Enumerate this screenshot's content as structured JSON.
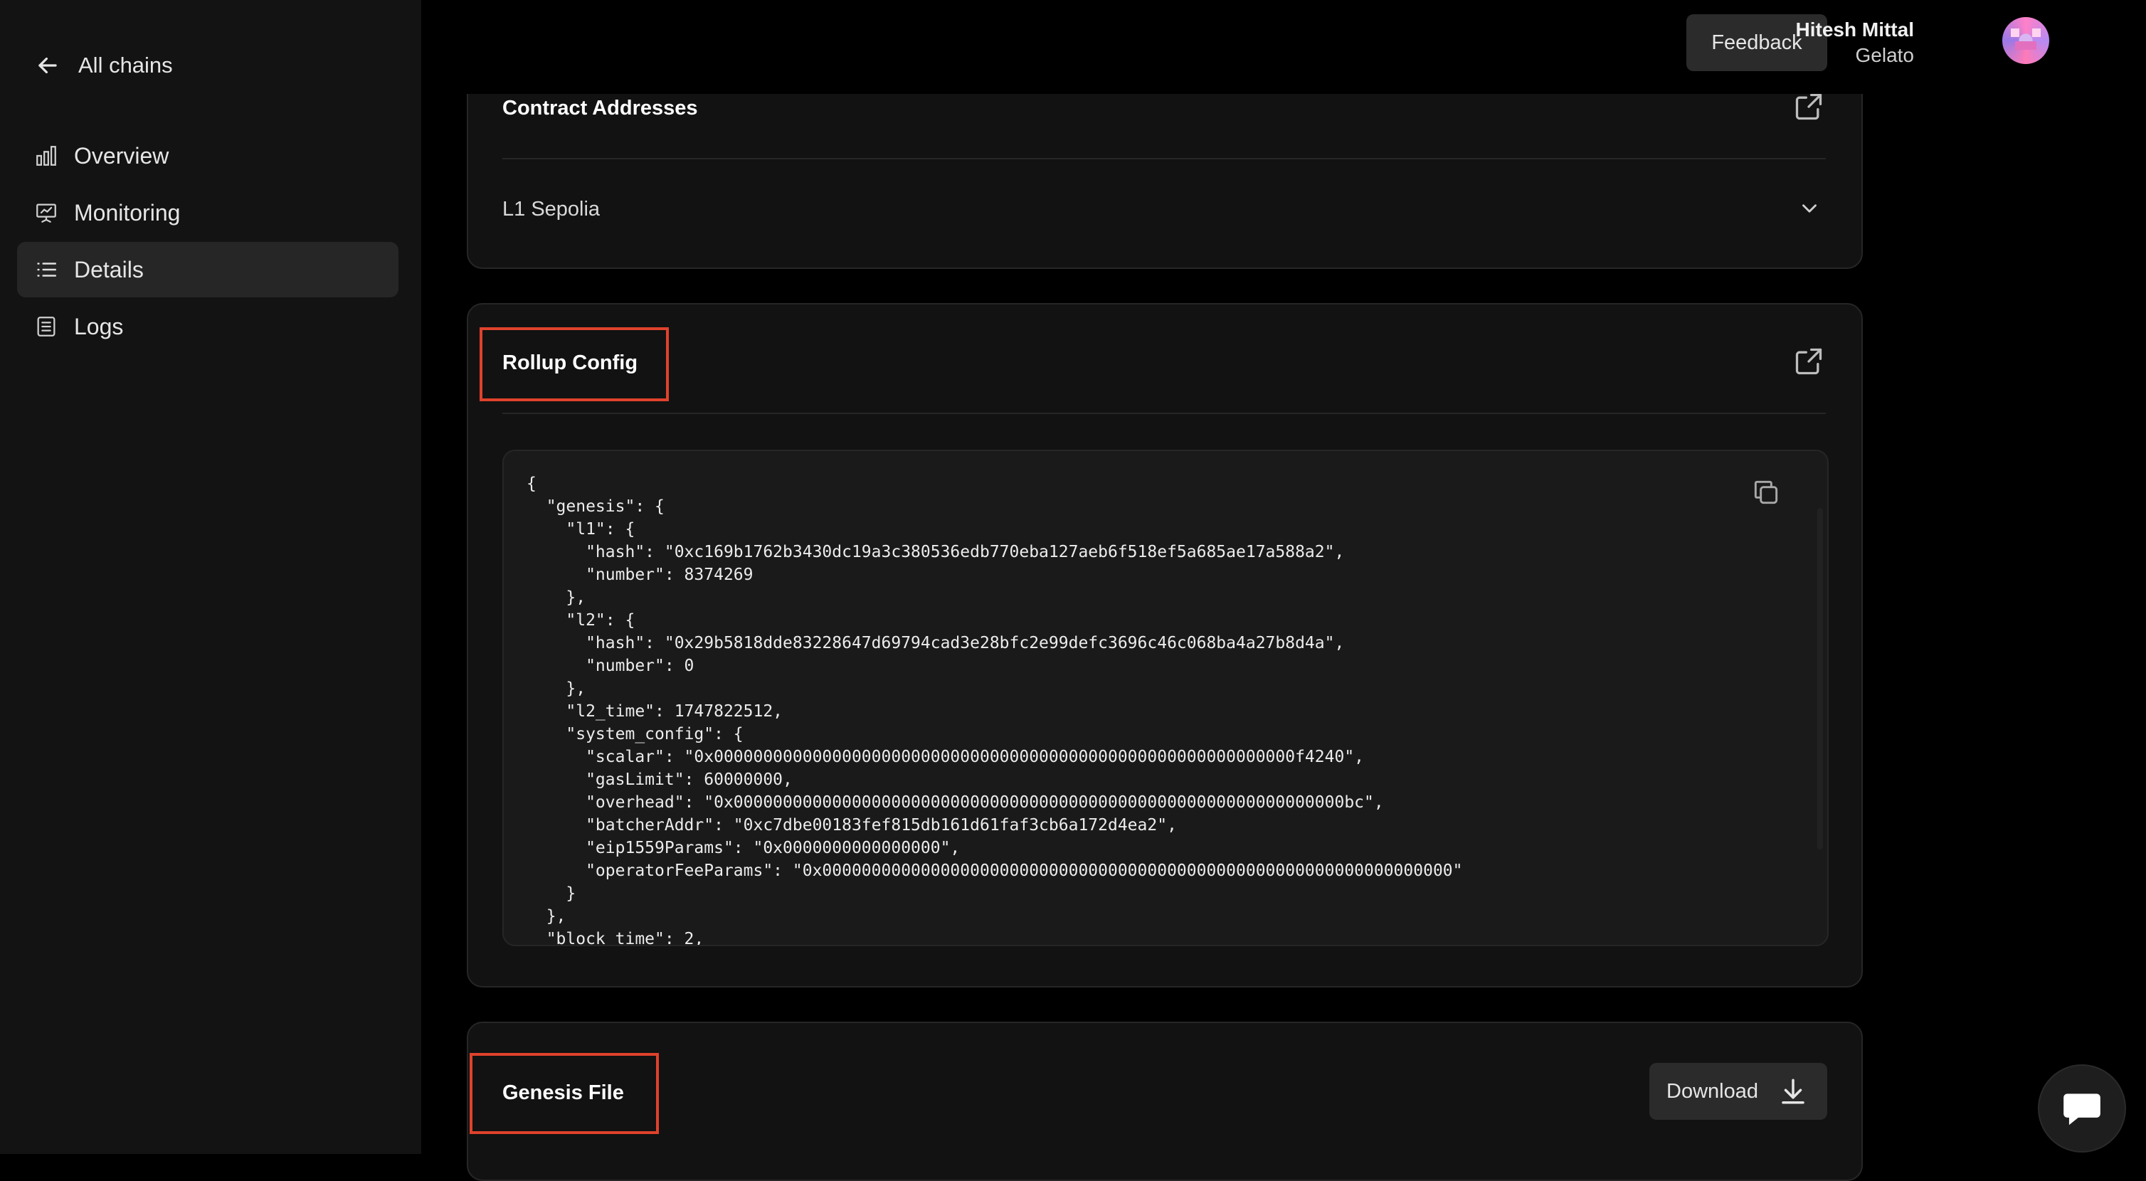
{
  "sidebar": {
    "back_label": "All chains",
    "items": [
      {
        "label": "Overview",
        "icon": "bar-chart-icon"
      },
      {
        "label": "Monitoring",
        "icon": "presentation-icon"
      },
      {
        "label": "Details",
        "icon": "list-icon",
        "active": true
      },
      {
        "label": "Logs",
        "icon": "log-icon"
      }
    ]
  },
  "header": {
    "feedback_label": "Feedback",
    "user_name": "Hitesh Mittal",
    "user_org": "Gelato"
  },
  "contract_addresses": {
    "title": "Contract Addresses",
    "network": "L1 Sepolia"
  },
  "rollup_config": {
    "title": "Rollup Config",
    "code": "{\n  \"genesis\": {\n    \"l1\": {\n      \"hash\": \"0xc169b1762b3430dc19a3c380536edb770eba127aeb6f518ef5a685ae17a588a2\",\n      \"number\": 8374269\n    },\n    \"l2\": {\n      \"hash\": \"0x29b5818dde83228647d69794cad3e28bfc2e99defc3696c46c068ba4a27b8d4a\",\n      \"number\": 0\n    },\n    \"l2_time\": 1747822512,\n    \"system_config\": {\n      \"scalar\": \"0x00000000000000000000000000000000000000000000000000000000000f4240\",\n      \"gasLimit\": 60000000,\n      \"overhead\": \"0x00000000000000000000000000000000000000000000000000000000000000bc\",\n      \"batcherAddr\": \"0xc7dbe00183fef815db161d61faf3cb6a172d4ea2\",\n      \"eip1559Params\": \"0x0000000000000000\",\n      \"operatorFeeParams\": \"0x0000000000000000000000000000000000000000000000000000000000000000\"\n    }\n  },\n  \"block_time\": 2,"
  },
  "genesis_file": {
    "title": "Genesis File",
    "download_label": "Download"
  },
  "colors": {
    "highlight": "#e0422c",
    "card_bg": "#121212",
    "sidebar_bg": "#131313"
  }
}
